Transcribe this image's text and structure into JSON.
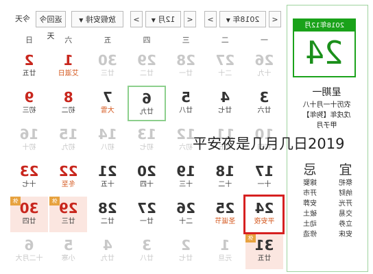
{
  "toolbar": {
    "today_btn": "今天",
    "back_today_btn": "返回今天",
    "holiday_select": "放假安排",
    "month_select": "12月",
    "year_select": "2018年",
    "prev": "<",
    "next": ">",
    "dropdown": "▼"
  },
  "left_panel": {
    "date_header": "2018年12月",
    "day_number": "24",
    "weekday": "星期一",
    "lunar_line": "农历十一月十八",
    "ganzhi_line": "戊戌年【狗年】",
    "month_gz": "甲子月",
    "ji_title": "忌",
    "yi_title": "宜",
    "ji_items": [
      "嫁娶",
      "开市",
      "安葬",
      "破土",
      "动土",
      "修造"
    ],
    "yi_items": [
      "祭祀",
      "纳财",
      "开光",
      "交易",
      "立券",
      "安床"
    ]
  },
  "weekdays": [
    "一",
    "二",
    "三",
    "四",
    "五",
    "六",
    "日"
  ],
  "weeks": [
    [
      {
        "n": "26",
        "l": "十九",
        "t": "faded"
      },
      {
        "n": "27",
        "l": "二十",
        "t": "faded"
      },
      {
        "n": "28",
        "l": "廿一",
        "t": "faded"
      },
      {
        "n": "29",
        "l": "廿二",
        "t": "faded"
      },
      {
        "n": "30",
        "l": "廿三",
        "t": "faded"
      },
      {
        "n": "1",
        "l": "艾滋日",
        "t": "fest"
      },
      {
        "n": "2",
        "l": "廿五",
        "t": "red"
      }
    ],
    [
      {
        "n": "3",
        "l": "廿六",
        "t": ""
      },
      {
        "n": "4",
        "l": "廿七",
        "t": ""
      },
      {
        "n": "5",
        "l": "廿八",
        "t": ""
      },
      {
        "n": "6",
        "l": "廿九",
        "t": "today"
      },
      {
        "n": "7",
        "l": "大雪",
        "t": "fest"
      },
      {
        "n": "8",
        "l": "初二",
        "t": "red"
      },
      {
        "n": "9",
        "l": "初三",
        "t": "red"
      }
    ],
    [
      {
        "n": "17",
        "l": "十一",
        "t": ""
      },
      {
        "n": "18",
        "l": "十二",
        "t": ""
      },
      {
        "n": "19",
        "l": "十三",
        "t": ""
      },
      {
        "n": "20",
        "l": "十四",
        "t": ""
      },
      {
        "n": "21",
        "l": "十五",
        "t": ""
      },
      {
        "n": "22",
        "l": "冬至",
        "t": "fest"
      },
      {
        "n": "23",
        "l": "十七",
        "t": "red"
      }
    ],
    [
      {
        "n": "24",
        "l": "平安夜",
        "t": "fest"
      },
      {
        "n": "25",
        "l": "圣诞节",
        "t": "fest"
      },
      {
        "n": "26",
        "l": "二十",
        "t": ""
      },
      {
        "n": "27",
        "l": "廿一",
        "t": ""
      },
      {
        "n": "28",
        "l": "廿二",
        "t": ""
      },
      {
        "n": "29",
        "l": "廿三",
        "t": "restday"
      },
      {
        "n": "30",
        "l": "廿四",
        "t": "restday"
      }
    ],
    [
      {
        "n": "31",
        "l": "廿五",
        "t": "restday"
      },
      {
        "n": "1",
        "l": "元旦",
        "t": "faded"
      },
      {
        "n": "2",
        "l": "廿七",
        "t": "faded"
      },
      {
        "n": "3",
        "l": "廿八",
        "t": "faded"
      },
      {
        "n": "4",
        "l": "廿九",
        "t": "faded"
      },
      {
        "n": "5",
        "l": "小寒",
        "t": "faded"
      },
      {
        "n": "6",
        "l": "十二月大",
        "t": "faded"
      }
    ]
  ],
  "faded_row": [
    {
      "n": "10",
      "l": "初四"
    },
    {
      "n": "11",
      "l": "初五"
    },
    {
      "n": "12",
      "l": "初六"
    },
    {
      "n": "13",
      "l": "初七"
    },
    {
      "n": "14",
      "l": "初八"
    },
    {
      "n": "15",
      "l": "初九"
    },
    {
      "n": "16",
      "l": "初十"
    }
  ],
  "rest_badge": "休",
  "overlay_title": "平安夜是几月几日2019",
  "colors": {
    "green": "#1aa21a",
    "red": "#c8261d",
    "festival": "#d4571d",
    "highlight": "#d62020"
  }
}
